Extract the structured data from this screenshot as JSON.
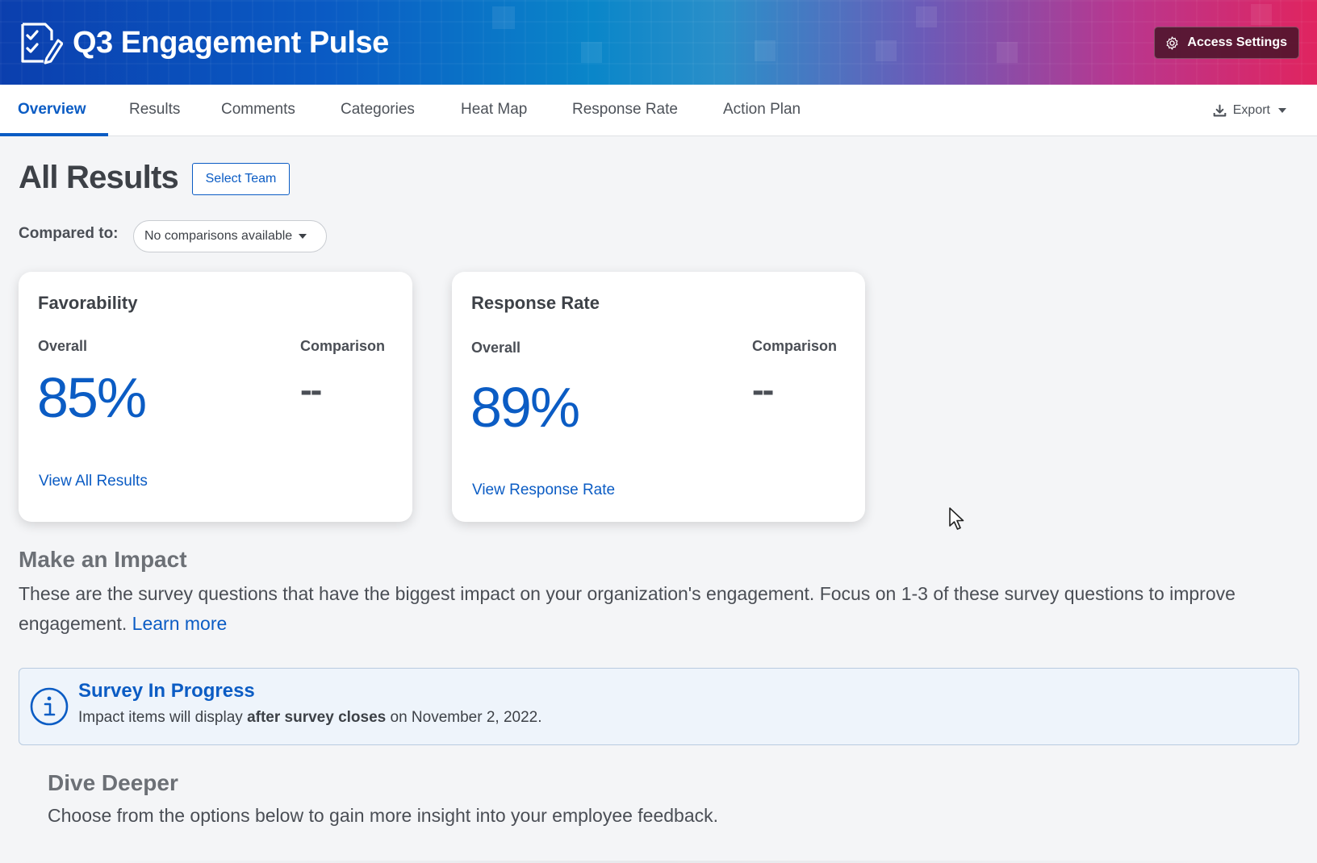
{
  "header": {
    "title": "Q3 Engagement Pulse",
    "access_settings_label": "Access Settings",
    "gradient_colors": [
      "#0b3fae",
      "#0a86c9",
      "#b8378f",
      "#e0245f"
    ]
  },
  "tabs": [
    {
      "label": "Overview",
      "active": true
    },
    {
      "label": "Results",
      "active": false
    },
    {
      "label": "Comments",
      "active": false
    },
    {
      "label": "Categories",
      "active": false
    },
    {
      "label": "Heat Map",
      "active": false
    },
    {
      "label": "Response Rate",
      "active": false
    },
    {
      "label": "Action Plan",
      "active": false
    }
  ],
  "export_label": "Export",
  "page": {
    "title": "All Results",
    "select_team_label": "Select Team",
    "compared_to_label": "Compared to:",
    "compared_to_value": "No comparisons available"
  },
  "cards": {
    "favorability": {
      "title": "Favorability",
      "overall_label": "Overall",
      "comparison_label": "Comparison",
      "overall_value": "85%",
      "comparison_value": "--",
      "link_label": "View All Results"
    },
    "response_rate": {
      "title": "Response Rate",
      "overall_label": "Overall",
      "comparison_label": "Comparison",
      "overall_value": "89%",
      "comparison_value": "--",
      "link_label": "View Response Rate"
    }
  },
  "impact": {
    "title": "Make an Impact",
    "description": "These are the survey questions that have the biggest impact on your organization's engagement. Focus on 1-3 of these survey questions to improve engagement.",
    "learn_more_label": "Learn more"
  },
  "notice": {
    "title": "Survey In Progress",
    "text_before": "Impact items will display ",
    "text_bold": "after survey closes",
    "text_after": " on November 2, 2022."
  },
  "dive_deeper": {
    "title": "Dive Deeper",
    "description": "Choose from the options below to gain more insight into your employee feedback."
  },
  "colors": {
    "accent": "#0b5cc4",
    "background": "#f4f5f7"
  },
  "icons": {
    "brand": "survey-checklist-icon",
    "access_settings": "gear-icon",
    "export": "download-icon",
    "notice": "info-icon"
  }
}
